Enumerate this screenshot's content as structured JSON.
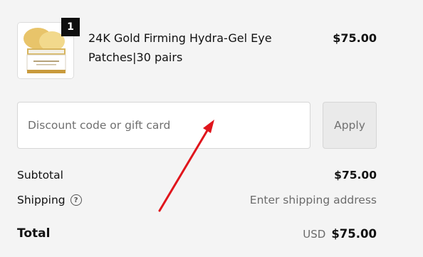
{
  "cart_item": {
    "name": "24K Gold Firming Hydra-Gel Eye Patches|30 pairs",
    "price": "$75.00",
    "quantity": "1",
    "thumbnail_icon": "product-jar-icon"
  },
  "discount": {
    "placeholder": "Discount code or gift card",
    "value": "",
    "apply_label": "Apply"
  },
  "summary": {
    "subtotal_label": "Subtotal",
    "subtotal_value": "$75.00",
    "shipping_label": "Shipping",
    "shipping_help_icon": "question-circle-icon",
    "shipping_value": "Enter shipping address",
    "total_label": "Total",
    "currency": "USD",
    "total_value": "$75.00"
  },
  "annotation": {
    "arrow_color": "#e0151c",
    "arrow_icon": "red-arrow-annotation"
  }
}
